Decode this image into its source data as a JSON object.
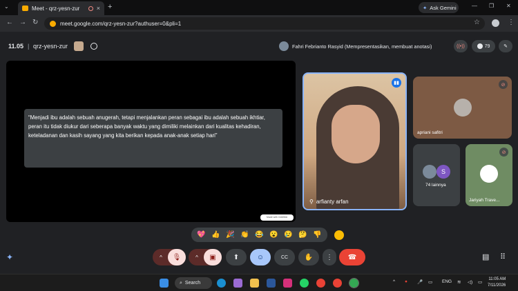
{
  "browser": {
    "tab_title": "Meet - qrz-yesn-zur",
    "tab_close": "×",
    "new_tab": "+",
    "gemini_label": "Ask Gemini",
    "url": "meet.google.com/qrz-yesn-zur?authuser=0&pli=1",
    "back": "←",
    "forward": "→",
    "reload": "↻",
    "star": "☆",
    "menu": "⋮",
    "min": "—",
    "max": "❐",
    "close": "✕"
  },
  "meet": {
    "time": "11.05",
    "separator": "|",
    "meeting_code": "qrz-yesn-zur",
    "presenter_text": "Fahri Febrianto Rasyid (Mempresentasikan, membuat anotasi)",
    "participant_count": "79"
  },
  "presentation": {
    "quote": "“Menjadi ibu adalah sebuah anugerah, tetapi menjalankan peran sebagai ibu adalah sebuah ikhtiar, peran itu tidak diukur dari seberapa banyak waktu yang dimiliki melainkan dari kualitas kehadiran, keteladanan dan kasih sayang yang kita berikan kepada anak-anak setiap hari”",
    "made_with": "Made with GAMMA"
  },
  "tiles": {
    "main_name": "arfianty arfan",
    "apriani_name": "apriani safitri",
    "others_avatar_letter": "S",
    "others_label": "74 lainnya",
    "jariyah_name": "Jariyah Trave..."
  },
  "reactions": [
    "💖",
    "👍",
    "🎉",
    "👏",
    "😂",
    "😮",
    "😢",
    "🤔",
    "👎"
  ],
  "controls": {
    "caret": "^",
    "mic_off": "🎙",
    "cam_off": "▣",
    "present": "⬆",
    "emoji": "☺",
    "captions": "CC",
    "hand": "✋",
    "more": "⋮",
    "end_call": "☎"
  },
  "taskbar": {
    "search_label": "Search",
    "lang": "ENG",
    "time": "11:05 AM",
    "date": "7/11/2026"
  },
  "colors": {
    "accent_blue": "#8ab4f8",
    "end_red": "#ea4335",
    "mute_red": "#f9dedc"
  }
}
